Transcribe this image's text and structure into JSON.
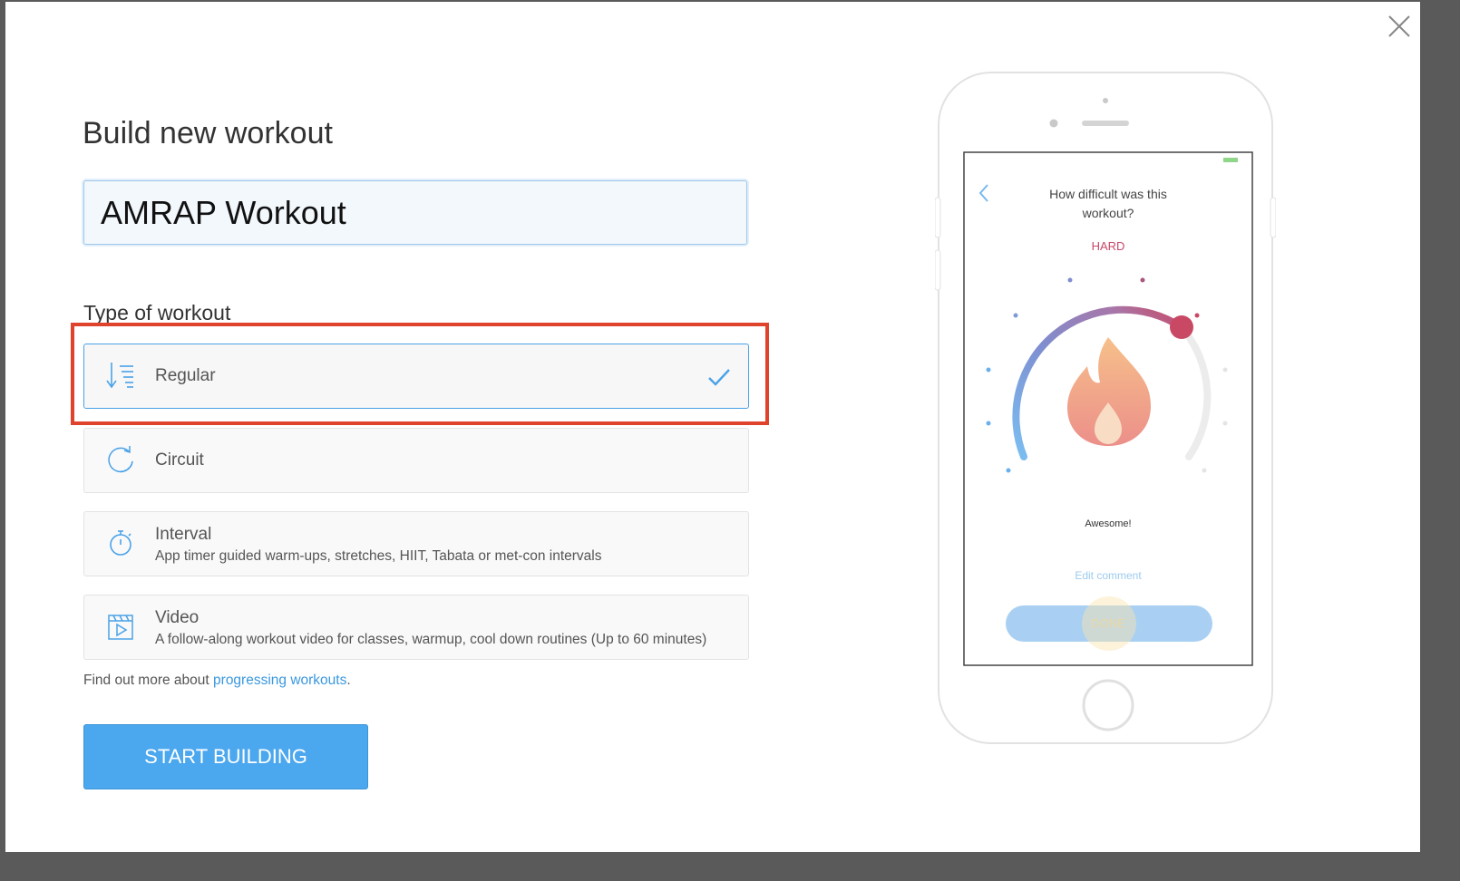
{
  "modal": {
    "title": "Build new workout",
    "workout_name": {
      "value": "AMRAP Workout",
      "placeholder": ""
    },
    "type_label": "Type of workout",
    "options": [
      {
        "label": "Regular",
        "description": "",
        "icon": "regular-list-icon",
        "selected": true
      },
      {
        "label": "Circuit",
        "description": "",
        "icon": "circuit-icon",
        "selected": false
      },
      {
        "label": "Interval",
        "description": "App timer guided warm-ups, stretches, HIIT, Tabata or met-con intervals",
        "icon": "stopwatch-icon",
        "selected": false
      },
      {
        "label": "Video",
        "description": "A follow-along workout video for classes, warmup, cool down routines (Up to 60 minutes)",
        "icon": "video-icon",
        "selected": false
      }
    ],
    "more_prefix": "Find out more about ",
    "more_link": "progressing workouts",
    "more_suffix": ".",
    "start_button": "START BUILDING"
  },
  "phone_preview": {
    "question": "How difficult was this workout?",
    "question_line1": "How difficult was this",
    "question_line2": "workout?",
    "difficulty": "HARD",
    "comment": "Awesome!",
    "edit_comment": "Edit comment",
    "done_button": "DONE"
  },
  "colors": {
    "accent": "#4ba7ee",
    "link": "#3a98df",
    "highlight": "#e0432c",
    "difficulty": "#c9486a"
  }
}
